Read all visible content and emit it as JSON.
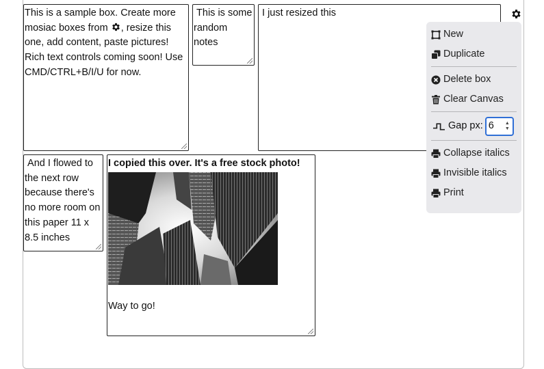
{
  "boxes": {
    "sample": {
      "text_before_icon": "This is a sample box. Create more mosiac boxes from ",
      "text_after_icon": ", resize this one, add content, paste pictures! Rich text controls coming soon! Use CMD/CTRL+B/I/U for now."
    },
    "notes": {
      "text": " This is some random notes"
    },
    "resized": {
      "text": " I just resized this"
    },
    "flowed": {
      "text": " And I flowed to the next row because there's no more room on this paper 11 x 8.5 inches"
    },
    "photo": {
      "caption": "I copied this over. It's a free stock photo!",
      "footer": "Way to go!",
      "image_icon": "skyscrapers-photo"
    }
  },
  "menu": {
    "new_label": "New",
    "duplicate_label": "Duplicate",
    "delete_label": "Delete box",
    "clear_label": "Clear Canvas",
    "gap_label": "Gap px:",
    "gap_value": "6",
    "collapse_label": "Collapse italics",
    "invisible_label": "Invisible italics",
    "print_label": "Print"
  },
  "icons": {
    "settings": "gear-icon",
    "new": "square-outline-icon",
    "duplicate": "copy-icon",
    "delete": "x-circle-icon",
    "clear": "trash-icon",
    "gap": "step-wave-icon",
    "print": "printer-icon"
  },
  "colors": {
    "menu_bg": "#e9e9ec",
    "input_focus": "#2f6fd6"
  }
}
